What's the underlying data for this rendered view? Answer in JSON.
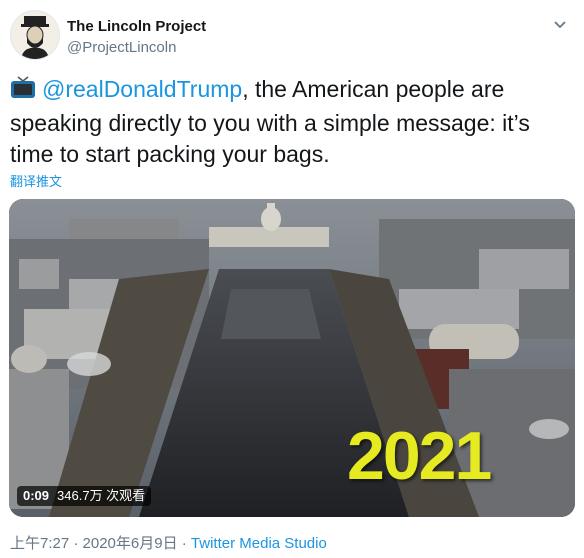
{
  "tweet": {
    "author_name": "The Lincoln Project",
    "author_handle": "@ProjectLincoln",
    "text_mention": "@realDonaldTrump",
    "text_body": ", the American people are speaking directly to you with a simple message: it’s time to start packing your bags.",
    "translate_label": "翻译推文",
    "footer_time": "上午7:27 · 2020年6月9日 · ",
    "footer_source": "Twitter Media Studio"
  },
  "video": {
    "duration": "0:09",
    "views": "346.7万 次观看",
    "overlay_text": "2021"
  },
  "icons": {
    "tv": "television-icon",
    "caret": "chevron-down-icon",
    "avatar": "lincoln-portrait-avatar"
  },
  "colors": {
    "link": "#1b95e0",
    "secondary_text": "#657786",
    "overlay_yellow": "#e6ea20"
  }
}
